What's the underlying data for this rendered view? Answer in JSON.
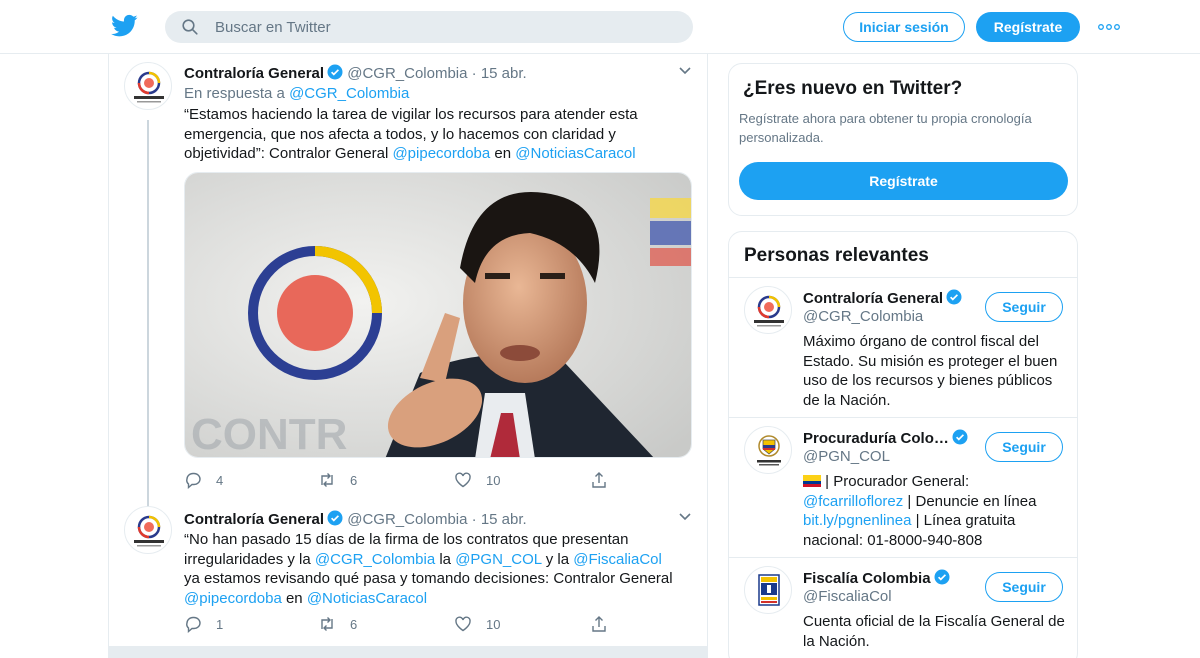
{
  "header": {
    "search_placeholder": "Buscar en Twitter",
    "login_label": "Iniciar sesión",
    "signup_label": "Regístrate"
  },
  "tweets": [
    {
      "name": "Contraloría General",
      "handle": "@CGR_Colombia",
      "dot": "·",
      "time": "15 abr.",
      "reply_prefix": "En respuesta a",
      "reply_handle": "@CGR_Colombia",
      "text_1": "“Estamos haciendo la tarea de vigilar los recursos para atender esta emergencia, que nos afecta a todos, y lo hacemos con claridad y objetividad”: Contralor General",
      "mention_1": "@pipecordoba",
      "text_2": "en",
      "mention_2": "@NoticiasCaracol",
      "replies": "4",
      "retweets": "6",
      "likes": "10"
    },
    {
      "name": "Contraloría General",
      "handle": "@CGR_Colombia",
      "dot": "·",
      "time": "15 abr.",
      "text_1": "“No han pasado 15 días de la firma de los contratos que presentan irregularidades y la",
      "mention_1": "@CGR_Colombia",
      "text_2": "la",
      "mention_2": "@PGN_COL",
      "text_3": "y la",
      "mention_3": "@FiscaliaCol",
      "text_4": "ya estamos revisando qué pasa y tomando decisiones: Contralor General",
      "mention_4": "@pipecordoba",
      "text_5": "en",
      "mention_5": "@NoticiasCaracol",
      "replies": "1",
      "retweets": "6",
      "likes": "10"
    }
  ],
  "sidebar": {
    "new_title": "¿Eres nuevo en Twitter?",
    "new_desc": "Regístrate ahora para obtener tu propia cronología personalizada.",
    "new_button": "Regístrate",
    "people_title": "Personas relevantes",
    "follow_label": "Seguir",
    "people": [
      {
        "name": "Contraloría General",
        "handle": "@CGR_Colombia",
        "desc": "Máximo órgano de control fiscal del Estado. Su misión es proteger el buen uso de los recursos y bienes públicos de la Nación."
      },
      {
        "name": "Procuraduría Colo…",
        "handle": "@PGN_COL",
        "flag": "🇨🇴",
        "desc_1": "| Procurador General:",
        "mention_1": "@fcarrilloflorez",
        "desc_2": "| Denuncie en línea",
        "link_1": "bit.ly/pgnenlinea",
        "desc_3": "| Línea gratuita nacional: 01-8000-940-808"
      },
      {
        "name": "Fiscalía Colombia",
        "handle": "@FiscaliaCol",
        "desc": "Cuenta oficial de la Fiscalía General de la Nación."
      }
    ]
  },
  "colors": {
    "brand_blue": "#1da1f2",
    "text_primary": "#14171a",
    "text_secondary": "#657786",
    "border": "#e6ecf0"
  },
  "icons": [
    "twitter-bird-icon",
    "search-icon",
    "more-icon",
    "verified-icon",
    "chevron-down-icon",
    "reply-icon",
    "retweet-icon",
    "like-icon",
    "share-icon"
  ]
}
